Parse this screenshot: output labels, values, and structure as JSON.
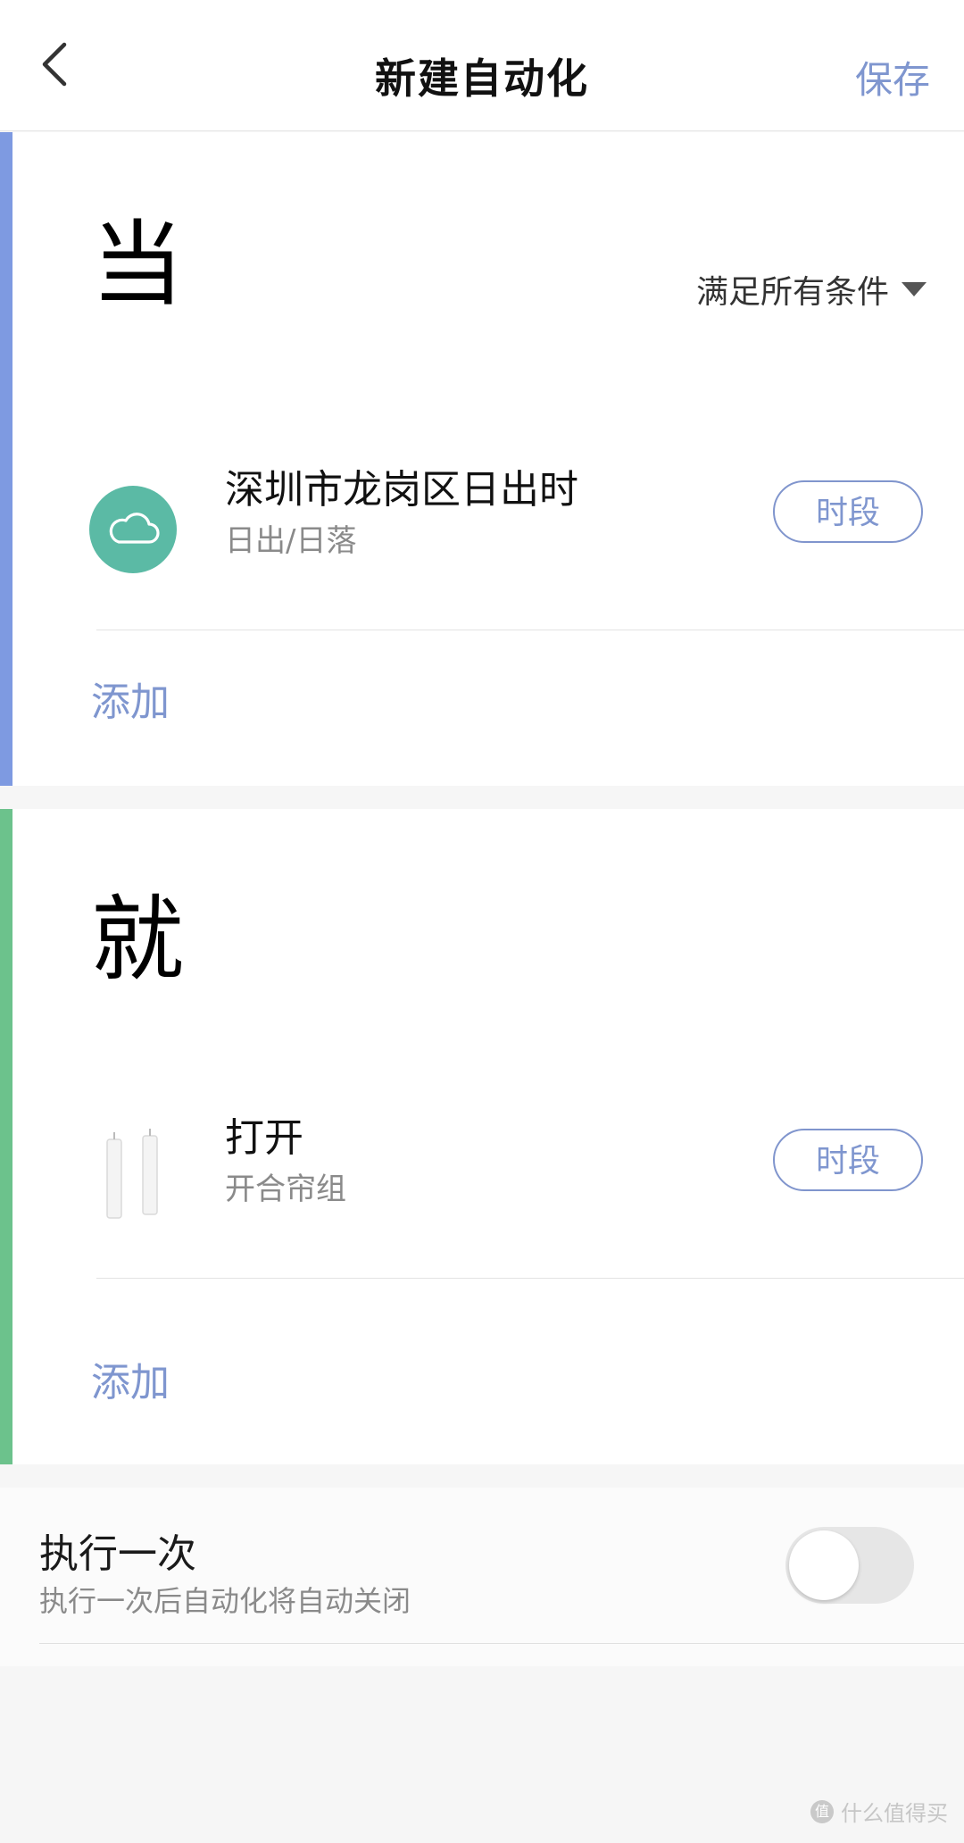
{
  "colors": {
    "accent": "#7f96cf",
    "when_bar": "#7e9ae1",
    "then_bar": "#6cc28c",
    "cloud_badge": "#5bbaa5",
    "toggle_off": "#e6e6e6"
  },
  "header": {
    "back_icon": "chevron-left-icon",
    "title": "新建自动化",
    "save_label": "保存"
  },
  "when": {
    "heading": "当",
    "condition_mode": "满足所有条件",
    "items": [
      {
        "icon": "cloud-icon",
        "title": "深圳市龙岗区日出时",
        "subtitle": "日出/日落",
        "time_label": "时段"
      }
    ],
    "add_label": "添加"
  },
  "then": {
    "heading": "就",
    "items": [
      {
        "icon": "curtain-icon",
        "title": "打开",
        "subtitle": "开合帘组",
        "time_label": "时段"
      }
    ],
    "add_label": "添加"
  },
  "execute_once": {
    "title": "执行一次",
    "subtitle": "执行一次后自动化将自动关闭",
    "enabled": false
  },
  "watermark": {
    "badge": "值",
    "text": "什么值得买"
  }
}
